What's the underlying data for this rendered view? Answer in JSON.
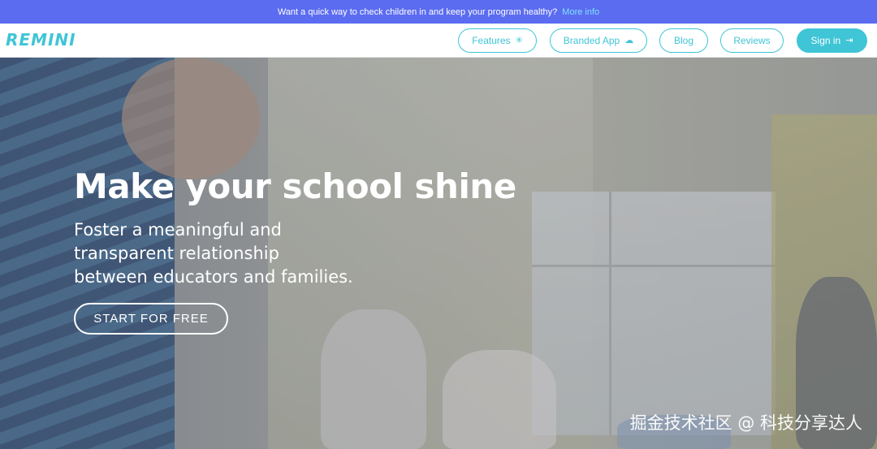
{
  "announcement": {
    "text": "Want a quick way to check children in and keep your program healthy?",
    "link": "More info"
  },
  "nav": {
    "logo": "REMINI",
    "items": [
      {
        "label": "Features",
        "icon": "spinner-icon"
      },
      {
        "label": "Branded App",
        "icon": "cloud-icon"
      },
      {
        "label": "Blog"
      },
      {
        "label": "Reviews"
      },
      {
        "label": "Sign in",
        "icon": "sign-in-icon"
      }
    ]
  },
  "hero": {
    "title": "Make your school shine",
    "subtitle_lines": [
      "Foster a meaningful and",
      "transparent relationship",
      "between educators and families."
    ],
    "cta": "START FOR FREE"
  },
  "watermark": "掘金技术社区 @ 科技分享达人",
  "colors": {
    "accent": "#3fc5d6",
    "announcement_bg": "#5b6cf0",
    "link": "#7fe3ff"
  }
}
